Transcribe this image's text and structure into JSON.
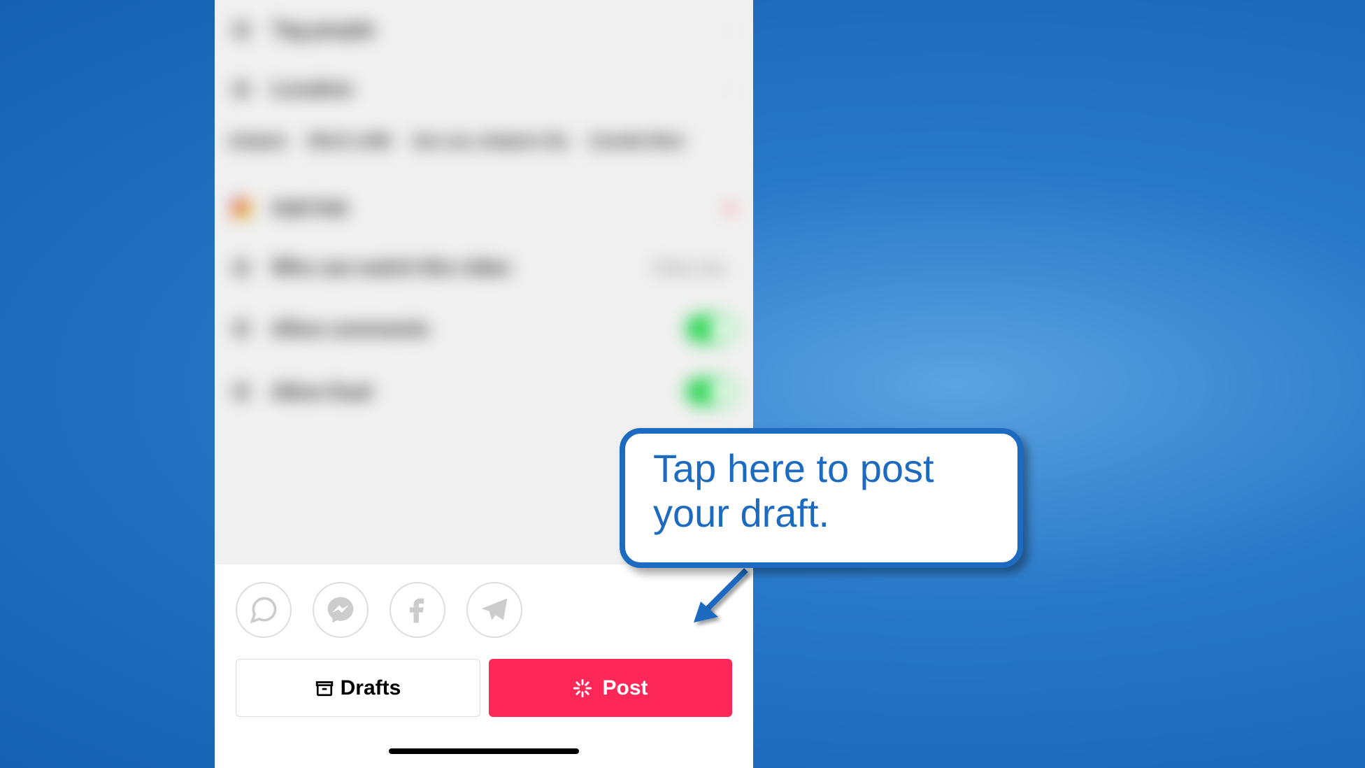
{
  "blurred_settings": {
    "tag_people": "Tag people",
    "location": "Location",
    "location_chips": [
      "Antipolo",
      "WALK LANE",
      "San Luis, Antipolo City",
      "Camella West"
    ],
    "add_link": "Add link",
    "who_can_watch": {
      "label": "Who can watch this video",
      "value": "Only me"
    },
    "allow_comments": "Allow comments",
    "allow_duet": "Allow Duet"
  },
  "share_targets": {
    "whatsapp": "WhatsApp",
    "messenger": "Messenger",
    "facebook": "Facebook",
    "telegram": "Telegram"
  },
  "buttons": {
    "drafts": "Drafts",
    "post": "Post"
  },
  "callout": {
    "text": "Tap here to post your draft."
  }
}
